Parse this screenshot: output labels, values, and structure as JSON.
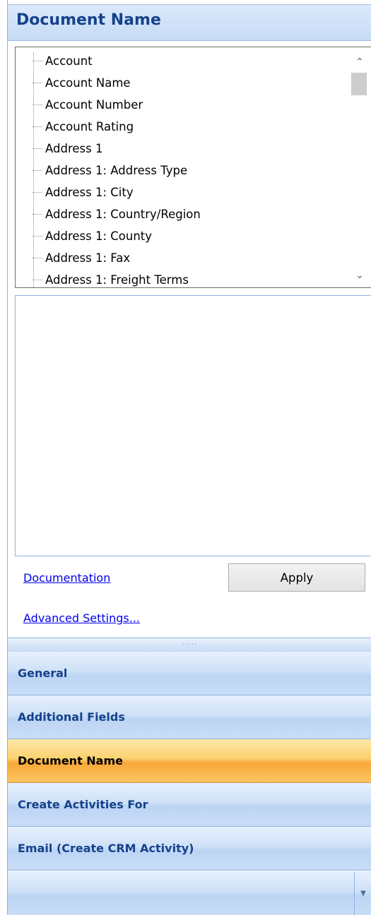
{
  "header": {
    "title": "Document Name"
  },
  "tree": {
    "items": [
      "Account",
      "Account Name",
      "Account Number",
      "Account Rating",
      "Address 1",
      "Address 1: Address Type",
      "Address 1: City",
      "Address 1: Country/Region",
      "Address 1: County",
      "Address 1: Fax",
      "Address 1: Freight Terms"
    ]
  },
  "actions": {
    "documentation_link": "Documentation",
    "apply_label": "Apply",
    "advanced_link": "Advanced Settings..."
  },
  "nav": {
    "items": [
      {
        "label": "General",
        "selected": false
      },
      {
        "label": "Additional Fields",
        "selected": false
      },
      {
        "label": "Document Name",
        "selected": true
      },
      {
        "label": "Create Activities For",
        "selected": false
      },
      {
        "label": "Email (Create CRM Activity)",
        "selected": false
      }
    ]
  },
  "colors": {
    "header_text": "#15428b",
    "selected_nav": "#f8a83a",
    "link": "#0000ee"
  }
}
